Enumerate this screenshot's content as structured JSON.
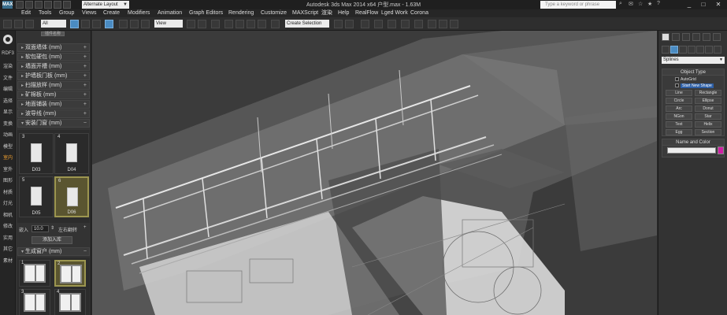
{
  "titlebar": {
    "app_icon": "MAX",
    "workspace": "Alternate Layout",
    "title": "Autodesk 3ds Max  2014 x64      户型.max - 1.63M",
    "search_placeholder": "Type a keyword or phrase",
    "controls": [
      "_",
      "□",
      "✕"
    ]
  },
  "menu": [
    "Edit",
    "Tools",
    "Group",
    "Views",
    "Create",
    "Modifiers",
    "Animation",
    "Graph Editors",
    "Rendering",
    "Customize",
    "MAXScript",
    "渲染",
    "Help",
    "RealFlow",
    "Lged Work",
    "Corona"
  ],
  "toolbar": {
    "filter": "All",
    "ref_coord": "View",
    "selection_set": "Create Selection Set"
  },
  "left_tabs": [
    "RDF3",
    "渲染",
    "文件",
    "编辑",
    "选择",
    "显示",
    "变换",
    "动画",
    "模型",
    "室内",
    "室外",
    "图形",
    "材质",
    "灯光",
    "相机",
    "修改",
    "实用",
    "其它",
    "素材"
  ],
  "left_tabs_active_index": 9,
  "left_panel": {
    "top_button": "插件名称",
    "categories": [
      "双面墙体 (mm)",
      "软包硬包 (mm)",
      "墙面开槽 (mm)",
      "护墙板门板 (mm)",
      "扫描放样 (mm)",
      "矿棉板 (mm)",
      "地面铺装 (mm)",
      "波导线 (mm)",
      "安装门窗 (mm)"
    ],
    "doors": [
      {
        "num": "3",
        "label": "D03",
        "selected": false
      },
      {
        "num": "4",
        "label": "D04",
        "selected": false
      },
      {
        "num": "5",
        "label": "D05",
        "selected": false
      },
      {
        "num": "6",
        "label": "D06",
        "selected": true
      }
    ],
    "inset_label": "嵌入",
    "inset_value": "10.0",
    "flip_label": "左右翻转",
    "add_library": "添加入库",
    "window_section": "生成窗户 (mm)",
    "windows": [
      {
        "num": "1",
        "selected": false
      },
      {
        "num": "2",
        "selected": true
      },
      {
        "num": "3",
        "selected": false
      },
      {
        "num": "4",
        "selected": false
      }
    ]
  },
  "command_panel": {
    "category": "Splines",
    "object_type_title": "Object Type",
    "autogrid": "AutoGrid",
    "start_new_shape": "Start New Shape",
    "buttons": [
      "Line",
      "Rectangle",
      "Circle",
      "Ellipse",
      "Arc",
      "Donut",
      "NGon",
      "Star",
      "Text",
      "Helix",
      "Egg",
      "Section"
    ],
    "name_color_title": "Name and Color",
    "object_color": "#d01fa4"
  }
}
